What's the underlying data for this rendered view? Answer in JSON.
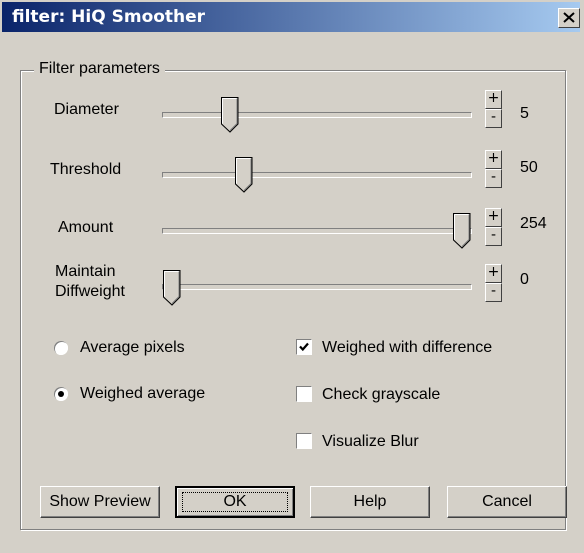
{
  "window": {
    "title": "filter: HiQ Smoother",
    "close_glyph": "X"
  },
  "groupbox": {
    "label": "Filter parameters"
  },
  "params": [
    {
      "label": "Diameter",
      "value": "5",
      "plus": "+",
      "minus": "-"
    },
    {
      "label": "Threshold",
      "value": "50",
      "plus": "+",
      "minus": "-"
    },
    {
      "label": "Amount",
      "value": "254",
      "plus": "+",
      "minus": "-"
    },
    {
      "label": "Maintain\nDiffweight",
      "value": "0",
      "plus": "+",
      "minus": "-"
    }
  ],
  "radios": [
    {
      "label": "Average pixels",
      "selected": false
    },
    {
      "label": "Weighed average",
      "selected": true
    }
  ],
  "checkboxes": [
    {
      "label": "Weighed with difference",
      "checked": true
    },
    {
      "label": "Check grayscale",
      "checked": false
    },
    {
      "label": "Visualize Blur",
      "checked": false
    }
  ],
  "buttons": {
    "show_preview": "Show Preview",
    "ok": "OK",
    "help": "Help",
    "cancel": "Cancel"
  },
  "colors": {
    "titlebar_start": "#0a246a",
    "titlebar_end": "#a6caf0",
    "face": "#d4d0c8"
  },
  "icons": {
    "close": "close-icon",
    "check": "checkmark-icon"
  }
}
